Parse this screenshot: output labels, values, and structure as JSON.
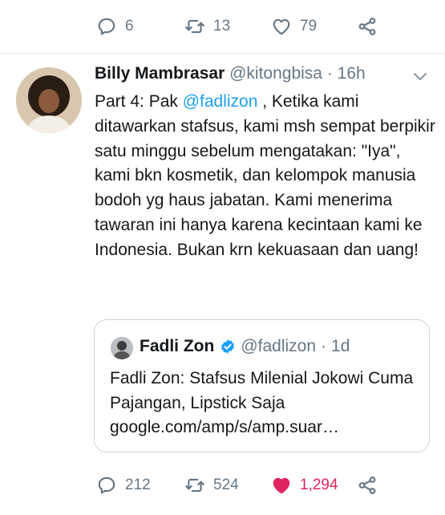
{
  "top_actions": {
    "replies": "6",
    "retweets": "13",
    "likes": "79"
  },
  "tweet": {
    "name": "Billy Mambrasar",
    "handle": "@kitongbisa",
    "separator": "·",
    "time": "16h",
    "text_before": "Part 4: Pak ",
    "mention": "@fadlizon",
    "text_after": " , Ketika kami ditawarkan stafsus, kami msh sempat berpikir satu minggu sebelum mengatakan: \"Iya\", kami bkn kosmetik, dan kelompok manusia bodoh yg haus jabatan. Kami menerima tawaran ini hanya karena kecintaan kami ke Indonesia. Bukan krn kekuasaan dan uang!"
  },
  "quoted": {
    "name": "Fadli Zon",
    "handle": "@fadlizon",
    "separator": "·",
    "time": "1d",
    "text": "Fadli Zon: Stafsus Milenial Jokowi Cuma Pajangan, Lipstick Saja google.com/amp/s/amp.suar…"
  },
  "bottom_actions": {
    "replies": "212",
    "retweets": "524",
    "likes": "1,294",
    "liked": true
  },
  "colors": {
    "accent": "#1da1f2",
    "like": "#e0245e",
    "muted": "#657786",
    "border": "#ccd6dd"
  },
  "icons": [
    "reply-icon",
    "retweet-icon",
    "heart-icon",
    "share-icon",
    "chevron-down-icon",
    "verified-badge-icon"
  ]
}
